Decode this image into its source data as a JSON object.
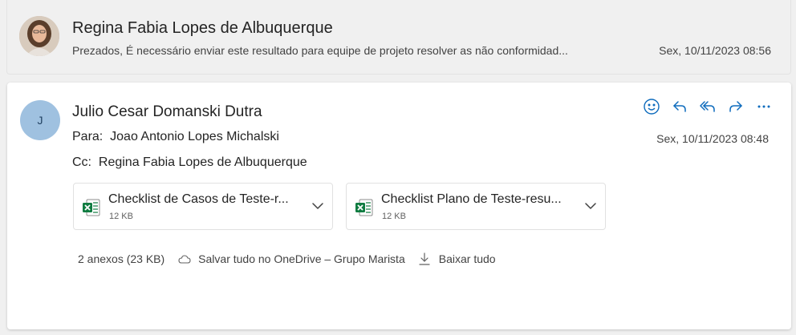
{
  "collapsed_message": {
    "sender": "Regina Fabia Lopes de Albuquerque",
    "preview": "Prezados, É necessário enviar este resultado para equipe de projeto resolver as não conformidad...",
    "date": "Sex, 10/11/2023 08:56"
  },
  "open_message": {
    "avatar_initial": "J",
    "sender": "Julio Cesar Domanski Dutra",
    "to_label": "Para:",
    "to_value": "Joao Antonio Lopes Michalski",
    "cc_label": "Cc:",
    "cc_value": "Regina Fabia Lopes de Albuquerque",
    "date": "Sex, 10/11/2023 08:48",
    "actions": {
      "react": "smiley-icon",
      "reply": "reply-icon",
      "reply_all": "reply-all-icon",
      "forward": "forward-icon",
      "more": "more-icon"
    },
    "attachments": [
      {
        "name": "Checklist de Casos de Teste-r...",
        "size": "12 KB",
        "icon": "excel-icon"
      },
      {
        "name": "Checklist Plano de Teste-resu...",
        "size": "12 KB",
        "icon": "excel-icon"
      }
    ],
    "footer": {
      "count": "2 anexos (23 KB)",
      "save_onedrive": "Salvar tudo no OneDrive – Grupo Marista",
      "download_all": "Baixar tudo"
    }
  },
  "colors": {
    "accent": "#0f6cbd",
    "avatar_bg": "#9fc1e0",
    "excel_green": "#107c41"
  }
}
